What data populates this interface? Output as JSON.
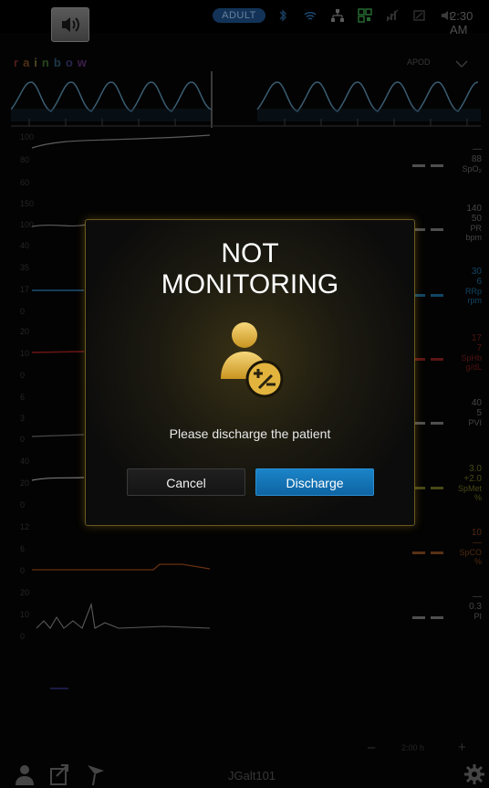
{
  "status_bar": {
    "patient_type": "ADULT",
    "time": "2:30 AM"
  },
  "brand": {
    "letters": [
      "r",
      "a",
      "i",
      "n",
      "b",
      "o",
      "w"
    ]
  },
  "waveform": {
    "mode_label": "APOD"
  },
  "trend_scales": {
    "spo2": [
      "100",
      "80",
      "60"
    ],
    "pr": [
      "150",
      "100",
      "40"
    ],
    "rrp": [
      "35",
      "17",
      "0"
    ],
    "sphb": [
      "20",
      "10",
      "0"
    ],
    "pvi": [
      "6",
      "3",
      "0"
    ],
    "spmet": [
      "40",
      "20",
      "0"
    ],
    "spco": [
      "12",
      "6",
      "0"
    ],
    "pi": [
      "20",
      "10",
      "0"
    ]
  },
  "parameters": [
    {
      "id": "spo2",
      "limits": [
        "—",
        "88"
      ],
      "label": "SpO₂",
      "color": "#8a8a8a"
    },
    {
      "id": "pr",
      "limits": [
        "140",
        "50"
      ],
      "label": "PR",
      "unit": "bpm",
      "color": "#8a8a8a"
    },
    {
      "id": "rrp",
      "limits": [
        "30",
        "6"
      ],
      "label": "RRp",
      "unit": "rpm",
      "color": "#1d6a9a"
    },
    {
      "id": "sphb",
      "limits": [
        "17",
        "7"
      ],
      "label": "SpHb",
      "unit": "g/dL",
      "color": "#8a1f1f"
    },
    {
      "id": "pvi",
      "limits": [
        "40",
        "5"
      ],
      "label": "PVI",
      "color": "#8a8a8a"
    },
    {
      "id": "spmet",
      "limits": [
        "3.0",
        "+2.0"
      ],
      "label": "SpMet",
      "unit": "%",
      "color": "#7b7c2a"
    },
    {
      "id": "spco",
      "limits": [
        "10",
        "—"
      ],
      "label": "SpCO",
      "unit": "%",
      "color": "#8a4a1f"
    },
    {
      "id": "pi",
      "limits": [
        "—",
        "0.3"
      ],
      "label": "PI",
      "color": "#8a8a8a"
    }
  ],
  "bottom_bar": {
    "patient_id": "JGalt101",
    "zoom_minus": "–",
    "zoom_plus": "+",
    "zoom_value": "2:00 h"
  },
  "dialog": {
    "title_line1": "NOT",
    "title_line2": "MONITORING",
    "message": "Please discharge the patient",
    "cancel_label": "Cancel",
    "discharge_label": "Discharge"
  },
  "colors": {
    "accent_gold": "#d9a931",
    "button_blue": "#1479bd",
    "pleth_blue": "#5a8fb0"
  },
  "icons": [
    "speaker-icon",
    "bluetooth-icon",
    "wifi-icon",
    "network-icon",
    "qr-icon",
    "signal-icon",
    "battery-icon",
    "volume-icon",
    "chevron-down-icon",
    "patient-icon",
    "export-icon",
    "flag-icon",
    "gear-icon",
    "patient-admit-discharge-icon"
  ]
}
